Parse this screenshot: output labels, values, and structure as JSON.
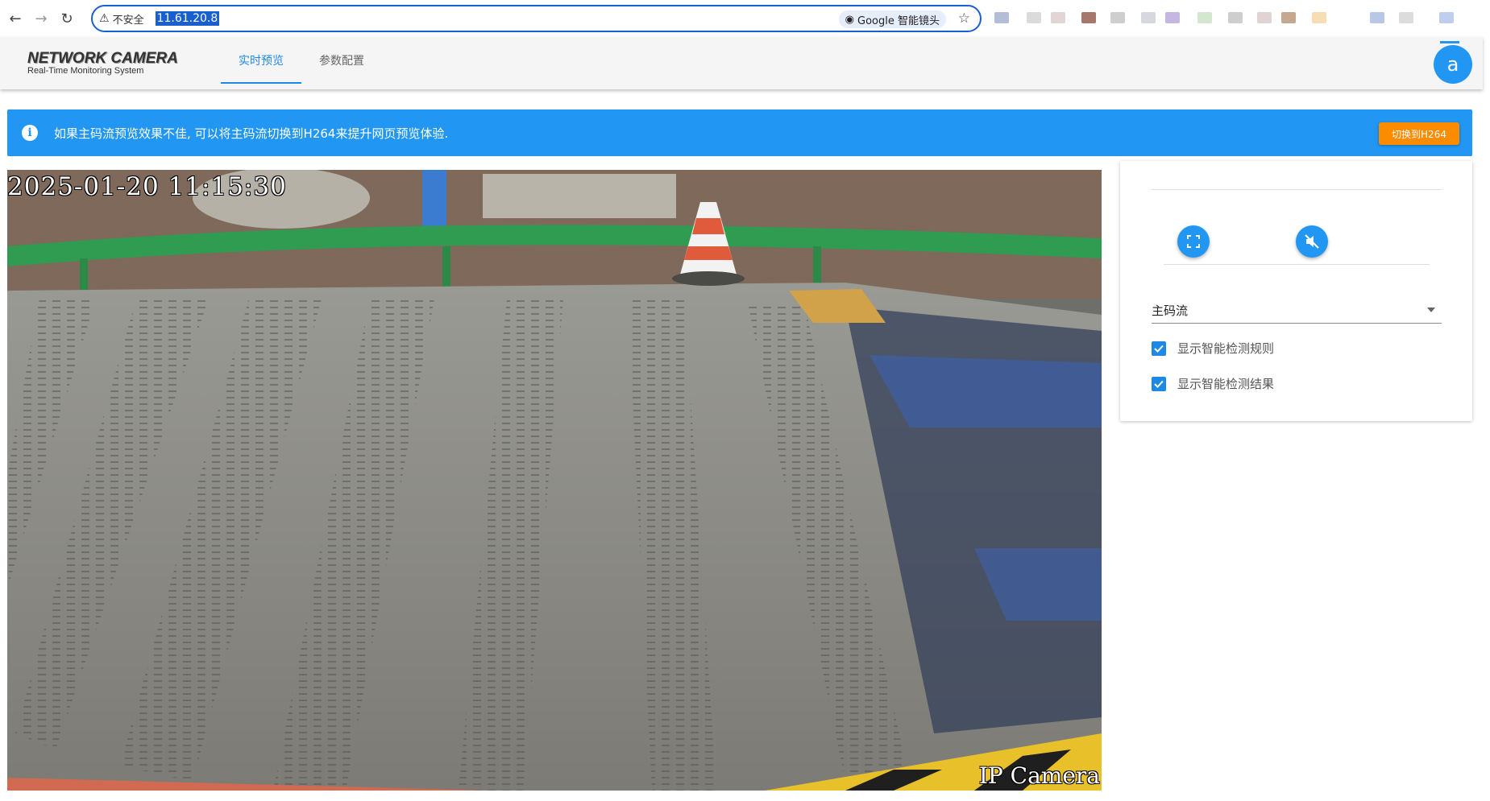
{
  "browser": {
    "security_label": "不安全",
    "url": "11.61.20.8",
    "lens_label": "Google 智能镜头"
  },
  "header": {
    "logo_title": "NETWORK CAMERA",
    "logo_subtitle": "Real-Time Monitoring System",
    "tabs": [
      {
        "label": "实时预览",
        "active": true
      },
      {
        "label": "参数配置",
        "active": false
      }
    ],
    "avatar_letter": "a"
  },
  "banner": {
    "message": "如果主码流预览效果不佳, 可以将主码流切换到H264来提升网页预览体验.",
    "button_label": "切换到H264"
  },
  "video": {
    "timestamp": "2025-01-20 11:15:30",
    "camera_label": "IP Camera"
  },
  "panel": {
    "stream_select": "主码流",
    "checkboxes": [
      {
        "label": "显示智能检测规则",
        "checked": true
      },
      {
        "label": "显示智能检测结果",
        "checked": true
      }
    ]
  },
  "colors": {
    "accent": "#2196f3",
    "banner_button": "#fb8c00"
  },
  "icons": {
    "fullscreen": "fullscreen-icon",
    "mute": "volume-off-icon",
    "info": "info-icon"
  }
}
